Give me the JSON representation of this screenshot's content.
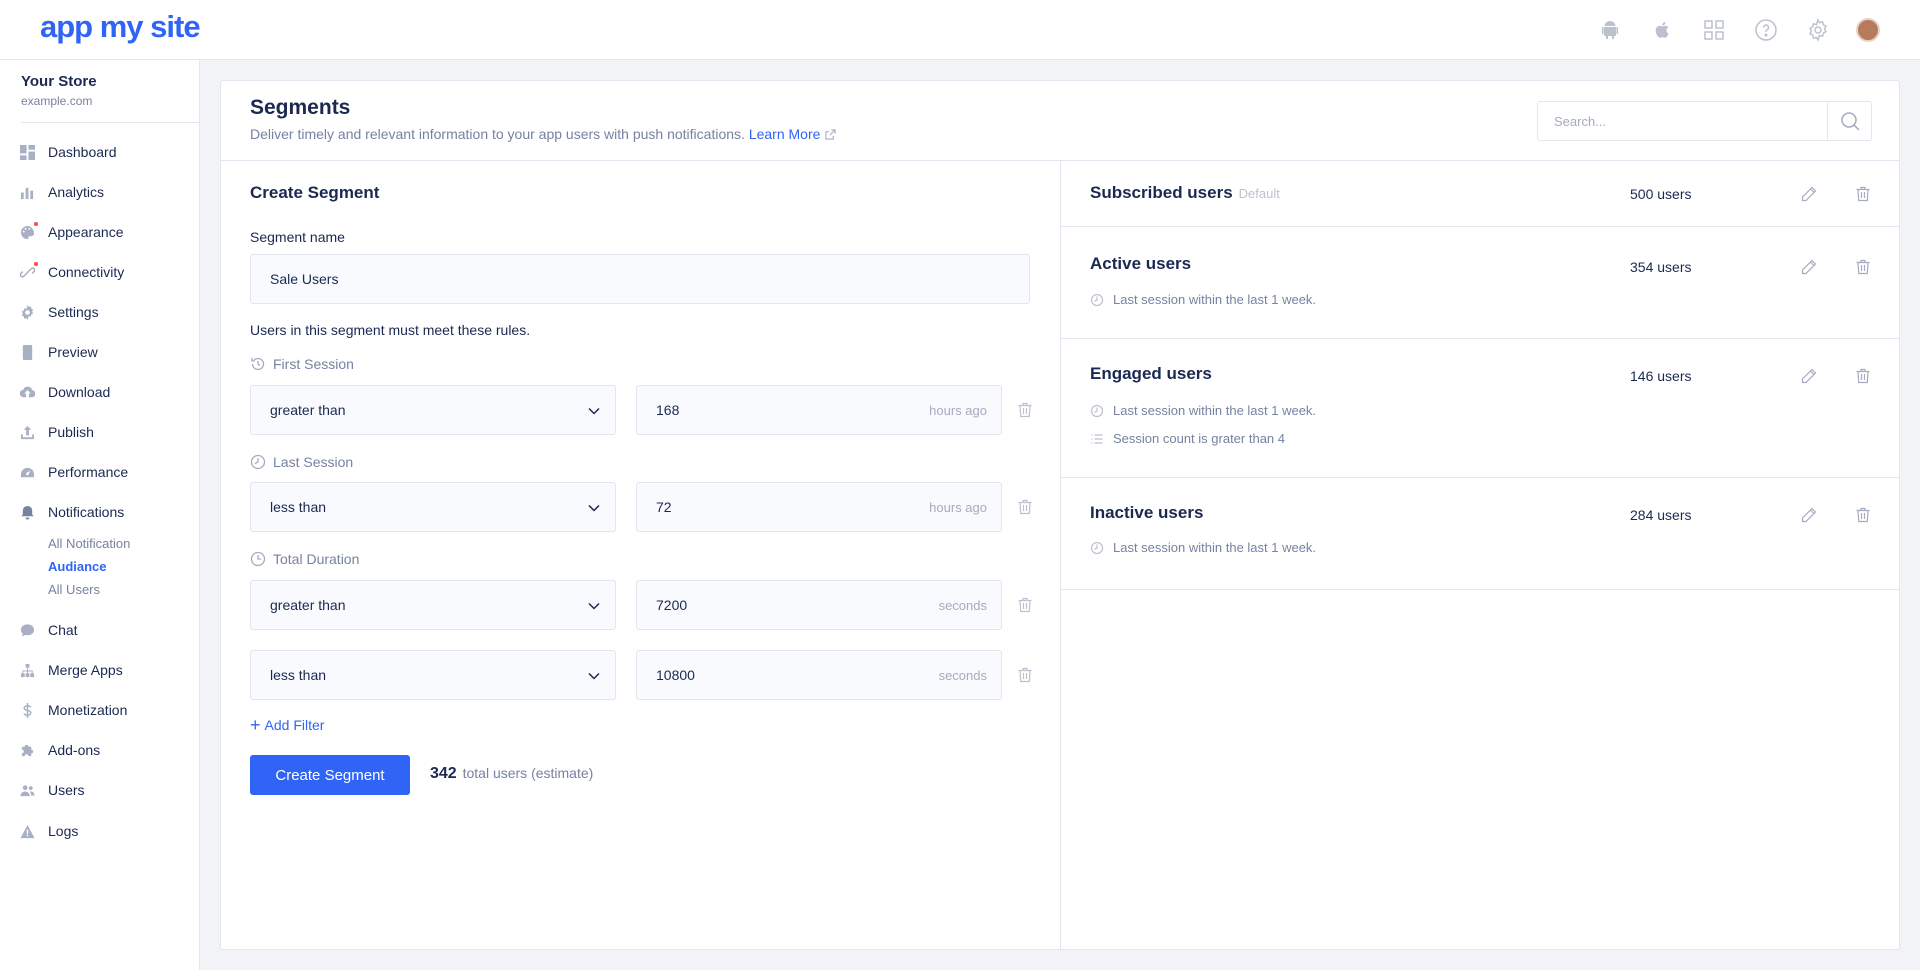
{
  "header": {
    "logo": "app my site"
  },
  "sidebar": {
    "store_name": "Your Store",
    "store_url": "example.com",
    "items": [
      {
        "label": "Dashboard",
        "icon": "dashboard-icon"
      },
      {
        "label": "Analytics",
        "icon": "analytics-icon"
      },
      {
        "label": "Appearance",
        "icon": "appearance-icon",
        "dot": true
      },
      {
        "label": "Connectivity",
        "icon": "connectivity-icon",
        "dot": true
      },
      {
        "label": "Settings",
        "icon": "gear-icon"
      },
      {
        "label": "Preview",
        "icon": "preview-icon"
      },
      {
        "label": "Download",
        "icon": "download-icon"
      },
      {
        "label": "Publish",
        "icon": "publish-icon"
      },
      {
        "label": "Performance",
        "icon": "performance-icon"
      },
      {
        "label": "Notifications",
        "icon": "bell-icon"
      },
      {
        "label": "Chat",
        "icon": "chat-icon"
      },
      {
        "label": "Merge Apps",
        "icon": "merge-icon"
      },
      {
        "label": "Monetization",
        "icon": "dollar-icon"
      },
      {
        "label": "Add-ons",
        "icon": "puzzle-icon"
      },
      {
        "label": "Users",
        "icon": "users-icon"
      },
      {
        "label": "Logs",
        "icon": "warning-icon"
      }
    ],
    "subitems": [
      {
        "label": "All Notification"
      },
      {
        "label": "Audiance",
        "active": true
      },
      {
        "label": "All Users"
      }
    ]
  },
  "page": {
    "title": "Segments",
    "subtitle": "Deliver timely and relevant information to your app users with push notifications.",
    "learn_more": "Learn More",
    "search_placeholder": "Search..."
  },
  "form": {
    "title": "Create Segment",
    "name_label": "Segment name",
    "name_value": "Sale Users",
    "rules_intro": "Users in this segment must meet these rules.",
    "groups": [
      {
        "label": "First Session"
      },
      {
        "label": "Last Session"
      },
      {
        "label": "Total Duration"
      }
    ],
    "rows": [
      {
        "operator": "greater than",
        "value": "168",
        "unit": "hours ago"
      },
      {
        "operator": "less than",
        "value": "72",
        "unit": "hours ago"
      },
      {
        "operator": "greater than",
        "value": "7200",
        "unit": "seconds"
      },
      {
        "operator": "less than",
        "value": "10800",
        "unit": "seconds"
      }
    ],
    "add_filter": "Add Filter",
    "create_button": "Create Segment",
    "estimate_count": "342",
    "estimate_text": "total users (estimate)"
  },
  "segments": [
    {
      "name": "Subscribed users",
      "badge": "Default",
      "count": "500 users",
      "rules": []
    },
    {
      "name": "Active users",
      "count": "354 users",
      "rules": [
        {
          "text": "Last session within the last 1 week.",
          "icon": "clock-icon"
        }
      ]
    },
    {
      "name": "Engaged users",
      "count": "146 users",
      "rules": [
        {
          "text": "Last session within the last 1 week.",
          "icon": "clock-icon"
        },
        {
          "text": "Session count is grater than 4",
          "icon": "list-icon"
        }
      ]
    },
    {
      "name": "Inactive users",
      "count": "284 users",
      "rules": [
        {
          "text": "Last session within the last 1 week.",
          "icon": "clock-icon"
        }
      ]
    }
  ],
  "colors": {
    "accent": "#3064f6",
    "text": "#1b2952",
    "muted": "#7782a1",
    "notification_dot": "#ff4848"
  }
}
